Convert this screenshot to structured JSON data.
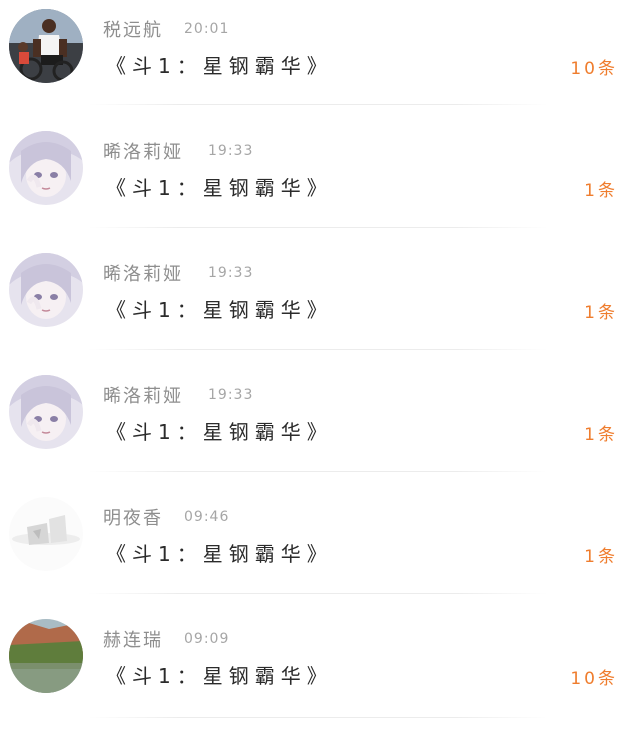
{
  "messages": [
    {
      "name": "税远航",
      "time": "20:01",
      "title": "《斗1：星钢霸华》",
      "count": "10条",
      "avatar": "photo-cyclist"
    },
    {
      "name": "晞洛莉娅",
      "time": "19:33",
      "title": "《斗1：星钢霸华》",
      "count": "1条",
      "avatar": "anime-girl"
    },
    {
      "name": "晞洛莉娅",
      "time": "19:33",
      "title": "《斗1：星钢霸华》",
      "count": "1条",
      "avatar": "anime-girl"
    },
    {
      "name": "晞洛莉娅",
      "time": "19:33",
      "title": "《斗1：星钢霸华》",
      "count": "1条",
      "avatar": "anime-girl"
    },
    {
      "name": "明夜香",
      "time": "09:46",
      "title": "《斗1：星钢霸华》",
      "count": "1条",
      "avatar": "blurred-logo"
    },
    {
      "name": "赫连瑞",
      "time": "09:09",
      "title": "《斗1：星钢霸华》",
      "count": "10条",
      "avatar": "landscape-photo"
    }
  ],
  "colors": {
    "count": "#ef7d2e",
    "name": "#8e8e8e",
    "title": "#2b2b2b"
  }
}
